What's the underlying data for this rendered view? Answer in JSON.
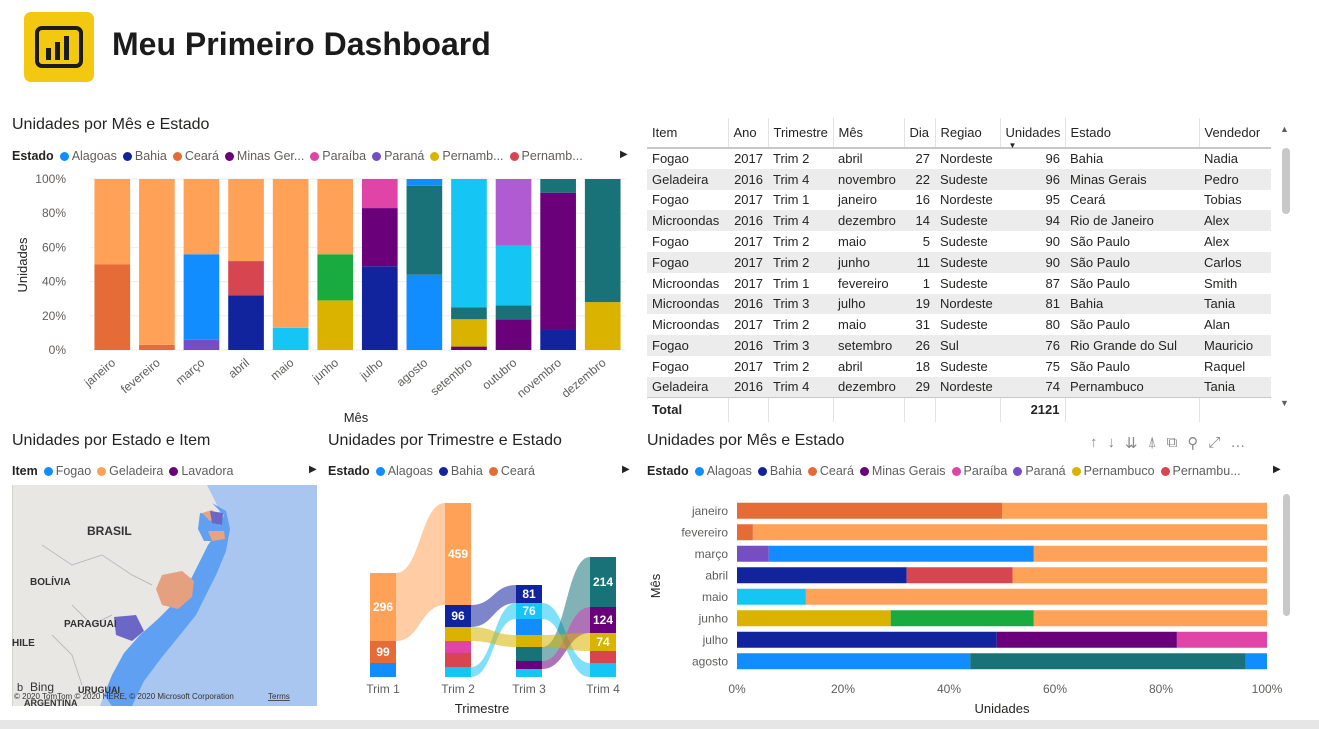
{
  "header": {
    "title": "Meu Primeiro Dashboard",
    "logo_icon": "power-bi-logo-icon",
    "logo_color": "#F2C811"
  },
  "colors": {
    "Alagoas": "#118DFF",
    "Bahia": "#12239E",
    "Ceará": "#E66C37",
    "Minas Gerais": "#6B007B",
    "Paraíba": "#E044A7",
    "Paraná": "#744EC2",
    "Pernambuco": "#D9B300",
    "Pernambuco2": "#D64550",
    "Rio de Janeiro": "#197278",
    "Rio Grande do Sul": "#1AAB40",
    "Santa Catarina": "#15C6F4",
    "São Paulo": "#FFA257",
    "Fogao": "#118DFF",
    "Geladeira": "#FFA257",
    "Lavadora": "#6B007B"
  },
  "chart1": {
    "title": "Unidades por Mês e Estado",
    "legend_title": "Estado",
    "legend": [
      {
        "label": "Alagoas",
        "color": "#118DFF"
      },
      {
        "label": "Bahia",
        "color": "#12239E"
      },
      {
        "label": "Ceará",
        "color": "#E66C37"
      },
      {
        "label": "Minas Ger...",
        "color": "#6B007B"
      },
      {
        "label": "Paraíba",
        "color": "#E044A7"
      },
      {
        "label": "Paraná",
        "color": "#744EC2"
      },
      {
        "label": "Pernamb...",
        "color": "#D9B300"
      },
      {
        "label": "Pernamb...",
        "color": "#D64550"
      }
    ],
    "legend_arrow": "▶"
  },
  "chart_data": [
    {
      "type": "bar",
      "orientation": "vertical",
      "stacked": "100%",
      "title": "Unidades por Mês e Estado",
      "xlabel": "Mês",
      "ylabel": "Unidades",
      "ylim": [
        0,
        1
      ],
      "yticks": [
        "0%",
        "20%",
        "40%",
        "60%",
        "80%",
        "100%"
      ],
      "categories": [
        "janeiro",
        "fevereiro",
        "março",
        "abril",
        "maio",
        "junho",
        "julho",
        "agosto",
        "setembro",
        "outubro",
        "novembro",
        "dezembro"
      ],
      "stacks": [
        [
          {
            "s": "Ceará",
            "v": 0.5
          },
          {
            "s": "São Paulo",
            "v": 0.5
          }
        ],
        [
          {
            "s": "Ceará",
            "v": 0.03
          },
          {
            "s": "São Paulo",
            "v": 0.97
          }
        ],
        [
          {
            "s": "Paraná",
            "v": 0.06
          },
          {
            "s": "Alagoas",
            "v": 0.5
          },
          {
            "s": "São Paulo",
            "v": 0.44
          }
        ],
        [
          {
            "s": "Bahia",
            "v": 0.32
          },
          {
            "s": "Pernambuco2",
            "v": 0.2
          },
          {
            "s": "São Paulo",
            "v": 0.48
          }
        ],
        [
          {
            "s": "Santa Catarina",
            "v": 0.13
          },
          {
            "s": "São Paulo",
            "v": 0.87
          }
        ],
        [
          {
            "s": "Pernambuco",
            "v": 0.29
          },
          {
            "s": "Rio Grande do Sul",
            "v": 0.27
          },
          {
            "s": "São Paulo",
            "v": 0.44
          }
        ],
        [
          {
            "s": "Bahia",
            "v": 0.49
          },
          {
            "s": "Minas Gerais",
            "v": 0.34
          },
          {
            "s": "Paraíba",
            "v": 0.17
          }
        ],
        [
          {
            "s": "Alagoas",
            "v": 0.44
          },
          {
            "s": "Rio de Janeiro",
            "v": 0.52
          },
          {
            "s": "Alagoas",
            "v": 0.04
          }
        ],
        [
          {
            "s": "Minas Gerais",
            "v": 0.02
          },
          {
            "s": "Pernambuco",
            "v": 0.16
          },
          {
            "s": "Rio de Janeiro",
            "v": 0.07
          },
          {
            "s": "Santa Catarina",
            "v": 0.75
          }
        ],
        [
          {
            "s": "Minas Gerais",
            "v": 0.18
          },
          {
            "s": "Rio de Janeiro",
            "v": 0.08
          },
          {
            "s": "Santa Catarina",
            "v": 0.35
          },
          {
            "s": "Lilac",
            "v": 0.39
          }
        ],
        [
          {
            "s": "Bahia",
            "v": 0.12
          },
          {
            "s": "Minas Gerais",
            "v": 0.8
          },
          {
            "s": "Rio de Janeiro",
            "v": 0.08
          }
        ],
        [
          {
            "s": "Pernambuco",
            "v": 0.28
          },
          {
            "s": "Rio de Janeiro",
            "v": 0.72
          }
        ]
      ]
    },
    {
      "type": "table",
      "columns": [
        "Item",
        "Ano",
        "Trimestre",
        "Mês",
        "Dia",
        "Regiao",
        "Unidades",
        "Estado",
        "Vendedor"
      ],
      "rows": [
        [
          "Fogao",
          "2017",
          "Trim 2",
          "abril",
          "27",
          "Nordeste",
          "96",
          "Bahia",
          "Nadia"
        ],
        [
          "Geladeira",
          "2016",
          "Trim 4",
          "novembro",
          "22",
          "Sudeste",
          "96",
          "Minas Gerais",
          "Pedro"
        ],
        [
          "Fogao",
          "2017",
          "Trim 1",
          "janeiro",
          "16",
          "Nordeste",
          "95",
          "Ceará",
          "Tobias"
        ],
        [
          "Microondas",
          "2016",
          "Trim 4",
          "dezembro",
          "14",
          "Sudeste",
          "94",
          "Rio de Janeiro",
          "Alex"
        ],
        [
          "Fogao",
          "2017",
          "Trim 2",
          "maio",
          "5",
          "Sudeste",
          "90",
          "São Paulo",
          "Alex"
        ],
        [
          "Fogao",
          "2017",
          "Trim 2",
          "junho",
          "11",
          "Sudeste",
          "90",
          "São Paulo",
          "Carlos"
        ],
        [
          "Microondas",
          "2017",
          "Trim 1",
          "fevereiro",
          "1",
          "Sudeste",
          "87",
          "São Paulo",
          "Smith"
        ],
        [
          "Microondas",
          "2016",
          "Trim 3",
          "julho",
          "19",
          "Nordeste",
          "81",
          "Bahia",
          "Tania"
        ],
        [
          "Microondas",
          "2017",
          "Trim 2",
          "maio",
          "31",
          "Sudeste",
          "80",
          "São Paulo",
          "Alan"
        ],
        [
          "Fogao",
          "2016",
          "Trim 3",
          "setembro",
          "26",
          "Sul",
          "76",
          "Rio Grande do Sul",
          "Mauricio"
        ],
        [
          "Fogao",
          "2017",
          "Trim 2",
          "abril",
          "18",
          "Sudeste",
          "75",
          "São Paulo",
          "Raquel"
        ],
        [
          "Geladeira",
          "2016",
          "Trim 4",
          "dezembro",
          "29",
          "Nordeste",
          "74",
          "Pernambuco",
          "Tania"
        ]
      ],
      "total_label": "Total",
      "total_value": "2121",
      "sorted_column": "Unidades"
    },
    {
      "type": "map",
      "title": "Unidades por Estado e Item",
      "legend_title": "Item",
      "legend": [
        {
          "label": "Fogao",
          "color": "#118DFF"
        },
        {
          "label": "Geladeira",
          "color": "#FFA257"
        },
        {
          "label": "Lavadora",
          "color": "#6B007B"
        }
      ],
      "place_labels": [
        "BRASIL",
        "BOLÍVIA",
        "PARAGUAI",
        "HILE",
        "URUGUAI",
        "ARGENTINA"
      ],
      "attribution": "© 2020 TomTom © 2020 HERE, © 2020 Microsoft Corporation",
      "terms": "Terms",
      "bing": "Bing"
    },
    {
      "type": "ribbon",
      "title": "Unidades por Trimestre e Estado",
      "xlabel": "Trimestre",
      "legend_title": "Estado",
      "legend": [
        {
          "label": "Alagoas",
          "color": "#118DFF"
        },
        {
          "label": "Bahia",
          "color": "#12239E"
        },
        {
          "label": "Ceará",
          "color": "#E66C37"
        }
      ],
      "categories": [
        "Trim 1",
        "Trim 2",
        "Trim 3",
        "Trim 4"
      ],
      "labels": [
        {
          "cat": "Trim 1",
          "value": "296",
          "series": "São Paulo"
        },
        {
          "cat": "Trim 1",
          "value": "99",
          "series": "Ceará"
        },
        {
          "cat": "Trim 2",
          "value": "459",
          "series": "São Paulo"
        },
        {
          "cat": "Trim 2",
          "value": "96",
          "series": "Bahia"
        },
        {
          "cat": "Trim 3",
          "value": "81",
          "series": "Bahia"
        },
        {
          "cat": "Trim 3",
          "value": "76",
          "series": "Santa Catarina"
        },
        {
          "cat": "Trim 4",
          "value": "214",
          "series": "Rio de Janeiro"
        },
        {
          "cat": "Trim 4",
          "value": "124",
          "series": "Minas Gerais"
        },
        {
          "cat": "Trim 4",
          "value": "74",
          "series": "Pernambuco"
        }
      ]
    },
    {
      "type": "bar",
      "orientation": "horizontal",
      "stacked": "100%",
      "title": "Unidades por Mês e Estado",
      "xlabel": "Unidades",
      "ylabel": "Mês",
      "xlim": [
        0,
        1
      ],
      "xticks": [
        "0%",
        "20%",
        "40%",
        "60%",
        "80%",
        "100%"
      ],
      "categories": [
        "janeiro",
        "fevereiro",
        "março",
        "abril",
        "maio",
        "junho",
        "julho",
        "agosto"
      ],
      "stacks": [
        [
          {
            "s": "Ceará",
            "v": 0.5
          },
          {
            "s": "São Paulo",
            "v": 0.5
          }
        ],
        [
          {
            "s": "Ceará",
            "v": 0.03
          },
          {
            "s": "São Paulo",
            "v": 0.97
          }
        ],
        [
          {
            "s": "Paraná",
            "v": 0.06
          },
          {
            "s": "Alagoas",
            "v": 0.5
          },
          {
            "s": "São Paulo",
            "v": 0.44
          }
        ],
        [
          {
            "s": "Bahia",
            "v": 0.32
          },
          {
            "s": "Pernambuco2",
            "v": 0.2
          },
          {
            "s": "São Paulo",
            "v": 0.48
          }
        ],
        [
          {
            "s": "Santa Catarina",
            "v": 0.13
          },
          {
            "s": "São Paulo",
            "v": 0.87
          }
        ],
        [
          {
            "s": "Pernambuco",
            "v": 0.29
          },
          {
            "s": "Rio Grande do Sul",
            "v": 0.27
          },
          {
            "s": "São Paulo",
            "v": 0.44
          }
        ],
        [
          {
            "s": "Bahia",
            "v": 0.49
          },
          {
            "s": "Minas Gerais",
            "v": 0.34
          },
          {
            "s": "Paraíba",
            "v": 0.17
          }
        ],
        [
          {
            "s": "Alagoas",
            "v": 0.44
          },
          {
            "s": "Rio de Janeiro",
            "v": 0.52
          },
          {
            "s": "Alagoas",
            "v": 0.04
          }
        ]
      ]
    }
  ],
  "chart5": {
    "title": "Unidades por Mês e Estado",
    "legend_title": "Estado",
    "legend": [
      {
        "label": "Alagoas",
        "color": "#118DFF"
      },
      {
        "label": "Bahia",
        "color": "#12239E"
      },
      {
        "label": "Ceará",
        "color": "#E66C37"
      },
      {
        "label": "Minas Gerais",
        "color": "#6B007B"
      },
      {
        "label": "Paraíba",
        "color": "#E044A7"
      },
      {
        "label": "Paraná",
        "color": "#744EC2"
      },
      {
        "label": "Pernambuco",
        "color": "#D9B300"
      },
      {
        "label": "Pernambu...",
        "color": "#D64550"
      }
    ],
    "toolbar": [
      "↑",
      "↓",
      "⇊",
      "⍋",
      "⧉",
      "⚲",
      "⤢",
      "…"
    ]
  }
}
